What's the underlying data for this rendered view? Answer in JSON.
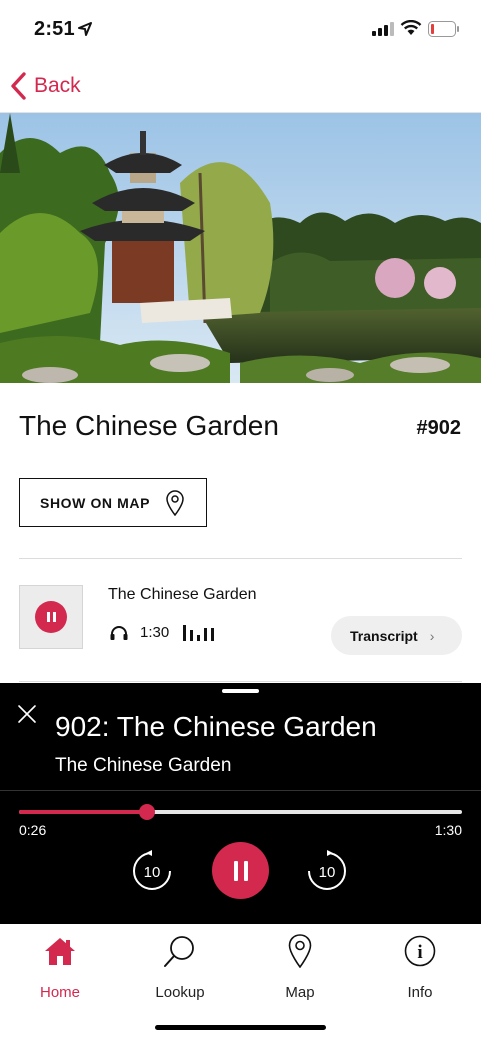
{
  "status_bar": {
    "time": "2:51"
  },
  "nav": {
    "back_label": "Back"
  },
  "stop": {
    "title": "The Chinese Garden",
    "number": "#902",
    "map_button_label": "SHOW ON MAP"
  },
  "track": {
    "title": "The Chinese Garden",
    "duration": "1:30",
    "transcript_label": "Transcript"
  },
  "player": {
    "title": "902: The Chinese Garden",
    "subtitle": "The Chinese Garden",
    "elapsed": "0:26",
    "total": "1:30",
    "progress_fraction": 0.289,
    "skip_back_label": "10",
    "skip_forward_label": "10"
  },
  "tabs": [
    {
      "label": "Home",
      "icon": "home-icon",
      "active": true
    },
    {
      "label": "Lookup",
      "icon": "search-icon",
      "active": false
    },
    {
      "label": "Map",
      "icon": "map-pin-icon",
      "active": false
    },
    {
      "label": "Info",
      "icon": "info-icon",
      "active": false
    }
  ],
  "colors": {
    "accent": "#d3294f",
    "player_bg": "#000000"
  }
}
